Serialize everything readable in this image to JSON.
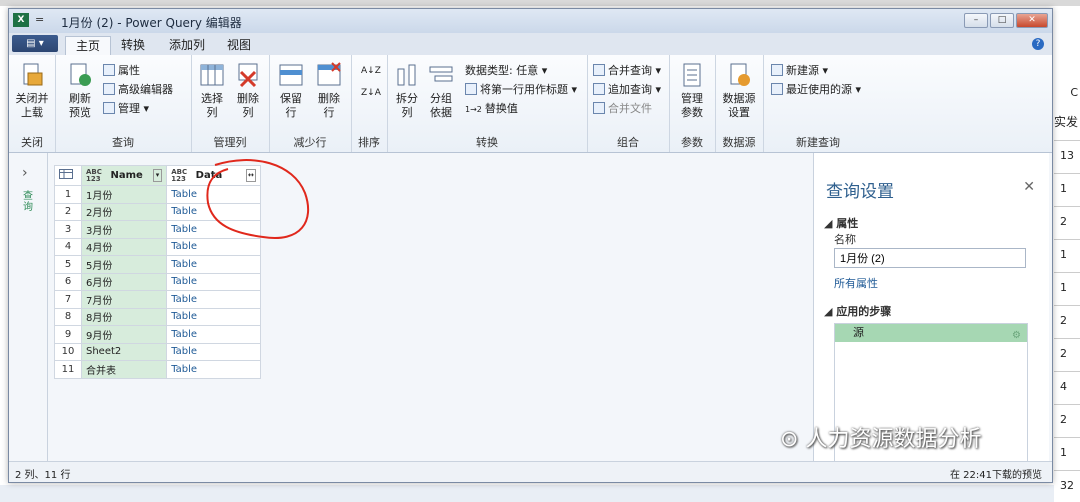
{
  "window": {
    "title": "1月份 (2) - Power Query 编辑器",
    "quick_access": "="
  },
  "tabs": {
    "file": "▤ ▾",
    "items": [
      "主页",
      "转换",
      "添加列",
      "视图"
    ],
    "active": "主页"
  },
  "ribbon": {
    "close": {
      "btn": "关闭并",
      "btn2": "上载",
      "group": "关闭"
    },
    "query": {
      "refresh": "刷新",
      "refresh2": "预览",
      "properties": "属性",
      "advanced": "高级编辑器",
      "manage": "管理",
      "group": "查询"
    },
    "manage_cols": {
      "choose": "选择",
      "choose2": "列",
      "remove": "删除",
      "remove2": "列",
      "group": "管理列"
    },
    "reduce_rows": {
      "keep": "保留",
      "keep2": "行",
      "remove": "删除",
      "remove2": "行",
      "group": "减少行"
    },
    "sort": {
      "group": "排序"
    },
    "transform": {
      "split": "拆分",
      "split2": "列",
      "group_by": "分组",
      "group_by2": "依据",
      "datatype": "数据类型: 任意",
      "first_row": "将第一行用作标题",
      "replace": "替换值",
      "group": "转换"
    },
    "combine": {
      "merge": "合并查询",
      "append": "追加查询",
      "combine_files": "合并文件",
      "group": "组合"
    },
    "params": {
      "manage": "管理",
      "manage2": "参数",
      "group": "参数"
    },
    "datasource": {
      "settings": "数据源",
      "settings2": "设置",
      "group": "数据源"
    },
    "newquery": {
      "new_source": "新建源",
      "recent": "最近使用的源",
      "group": "新建查询"
    }
  },
  "left_pane": {
    "label": "查询"
  },
  "grid": {
    "columns": [
      {
        "type": "ABC 123",
        "name": "Name"
      },
      {
        "type": "ABC 123",
        "name": "Data"
      }
    ],
    "rows": [
      {
        "n": "1",
        "name": "1月份",
        "data": "Table"
      },
      {
        "n": "2",
        "name": "2月份",
        "data": "Table"
      },
      {
        "n": "3",
        "name": "3月份",
        "data": "Table"
      },
      {
        "n": "4",
        "name": "4月份",
        "data": "Table"
      },
      {
        "n": "5",
        "name": "5月份",
        "data": "Table"
      },
      {
        "n": "6",
        "name": "6月份",
        "data": "Table"
      },
      {
        "n": "7",
        "name": "7月份",
        "data": "Table"
      },
      {
        "n": "8",
        "name": "8月份",
        "data": "Table"
      },
      {
        "n": "9",
        "name": "9月份",
        "data": "Table"
      },
      {
        "n": "10",
        "name": "Sheet2",
        "data": "Table"
      },
      {
        "n": "11",
        "name": "合并表",
        "data": "Table"
      }
    ]
  },
  "settings": {
    "title": "查询设置",
    "properties": "属性",
    "name_label": "名称",
    "name_value": "1月份 (2)",
    "all_props": "所有属性",
    "applied_steps": "应用的步骤",
    "steps": [
      "源"
    ]
  },
  "status": {
    "left": "2 列、11 行",
    "right": "在 22:41下载的预览"
  },
  "background_sheet": {
    "header_top": "C",
    "header": "实发",
    "cells": [
      "13",
      "1",
      "2",
      "1",
      "1",
      "2",
      "2",
      "4",
      "2",
      "1",
      "32"
    ]
  },
  "watermark": "人力资源数据分析"
}
